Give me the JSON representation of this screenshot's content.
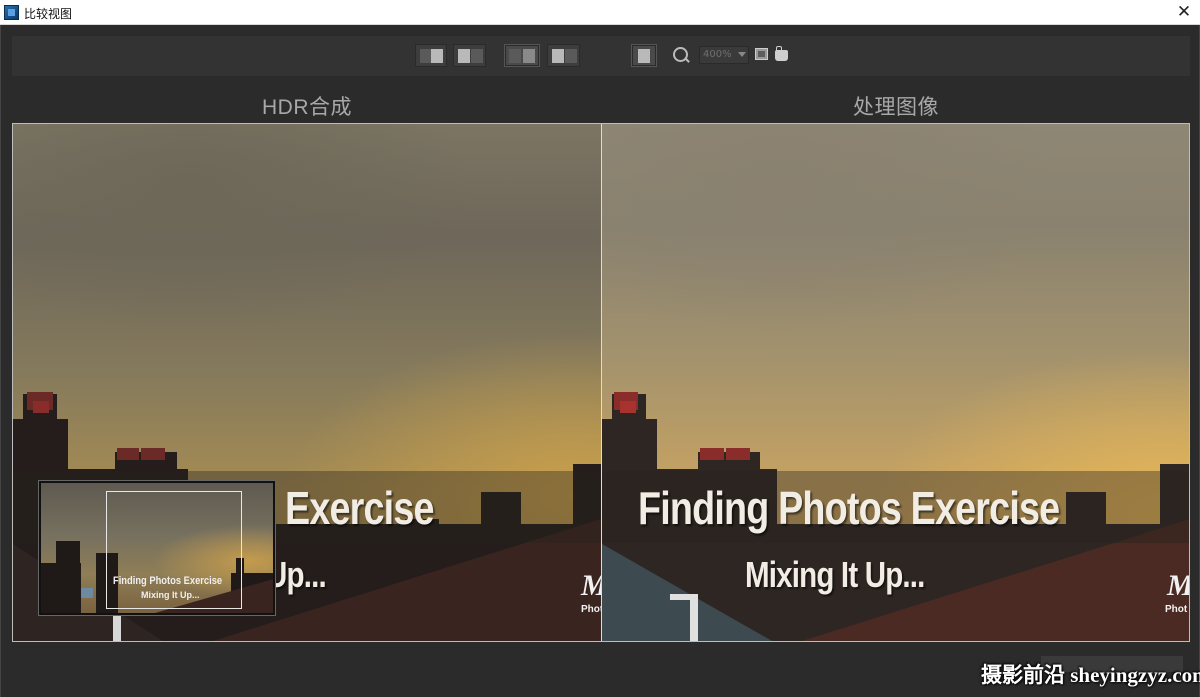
{
  "window": {
    "title": "比较视图",
    "close_glyph": "✕"
  },
  "toolbar": {
    "zoom_value": "400%",
    "view_modes": [
      "single-view",
      "split-view-a",
      "side-by-side",
      "split-view-b"
    ],
    "active_mode": "side-by-side"
  },
  "panels": {
    "left_label": "HDR合成",
    "right_label": "处理图像"
  },
  "image": {
    "title_text": "Finding Photos Exercise",
    "title_visible_left": "Exercise",
    "subtitle_text": "Mixing It Up...",
    "subtitle_visible_left": "Up...",
    "logo_mark": "M",
    "logo_word": "Phot"
  },
  "navigator": {
    "title": "Finding Photos Exercise",
    "subtitle": "Mixing It Up..."
  },
  "watermark": "摄影前沿 sheyingzyz.com",
  "colors": {
    "background": "#2b2b2b",
    "toolbar": "#333333",
    "label": "#a8a8a8"
  }
}
